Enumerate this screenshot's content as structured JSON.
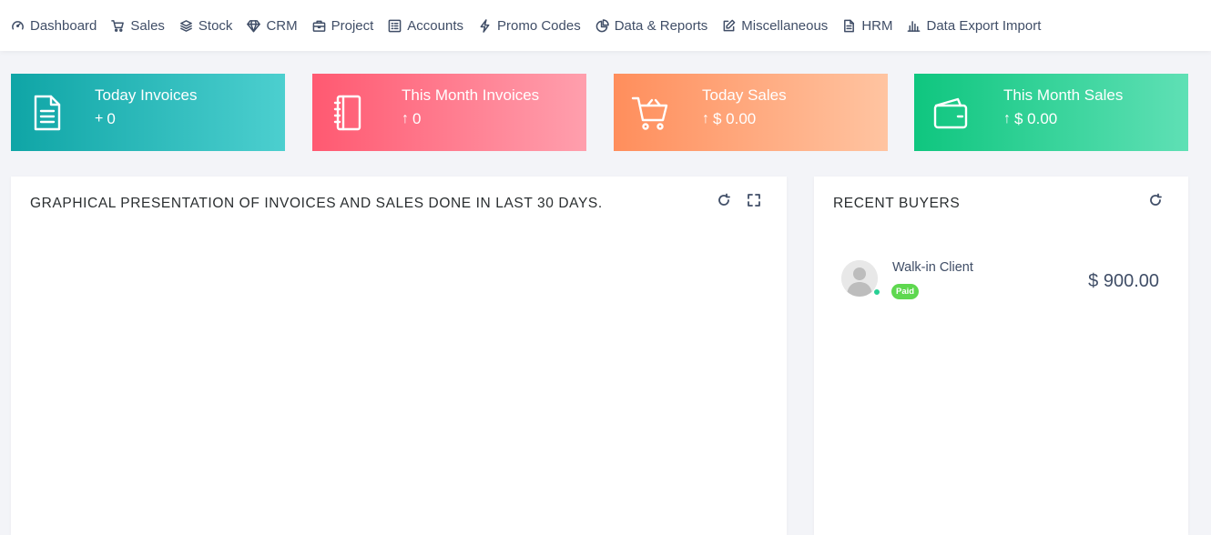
{
  "nav": {
    "items": [
      {
        "label": "Dashboard",
        "icon": "dashboard-gauge-icon"
      },
      {
        "label": "Sales",
        "icon": "shopping-cart-icon"
      },
      {
        "label": "Stock",
        "icon": "layers-icon"
      },
      {
        "label": "CRM",
        "icon": "diamond-icon"
      },
      {
        "label": "Project",
        "icon": "briefcase-icon"
      },
      {
        "label": "Accounts",
        "icon": "ledger-icon"
      },
      {
        "label": "Promo Codes",
        "icon": "lightning-icon"
      },
      {
        "label": "Data & Reports",
        "icon": "pie-chart-icon"
      },
      {
        "label": "Miscellaneous",
        "icon": "edit-icon"
      },
      {
        "label": "HRM",
        "icon": "document-icon"
      },
      {
        "label": "Data Export Import",
        "icon": "bar-chart-icon"
      }
    ]
  },
  "cards": [
    {
      "title": "Today Invoices",
      "arrow": "+",
      "value": "0",
      "icon": "file-text-icon"
    },
    {
      "title": "This Month Invoices",
      "arrow": "↑",
      "value": "0",
      "icon": "notebook-icon"
    },
    {
      "title": "Today Sales",
      "arrow": "↑",
      "value": "$ 0.00",
      "icon": "cart-icon"
    },
    {
      "title": "This Month Sales",
      "arrow": "↑",
      "value": "$ 0.00",
      "icon": "wallet-icon"
    }
  ],
  "graph_panel": {
    "title": "GRAPHICAL PRESENTATION OF INVOICES AND SALES DONE IN LAST 30 DAYS."
  },
  "buyers_panel": {
    "title": "RECENT BUYERS",
    "buyers": [
      {
        "name": "Walk-in Client",
        "status": "Paid",
        "amount": "$ 900.00"
      }
    ]
  },
  "colors": {
    "card1": "#0fa5a6",
    "card2": "#ff5971",
    "card3": "#ff8e5c",
    "card4": "#0fc67f",
    "paid_badge": "#5ed84f",
    "online_dot": "#28d094"
  }
}
